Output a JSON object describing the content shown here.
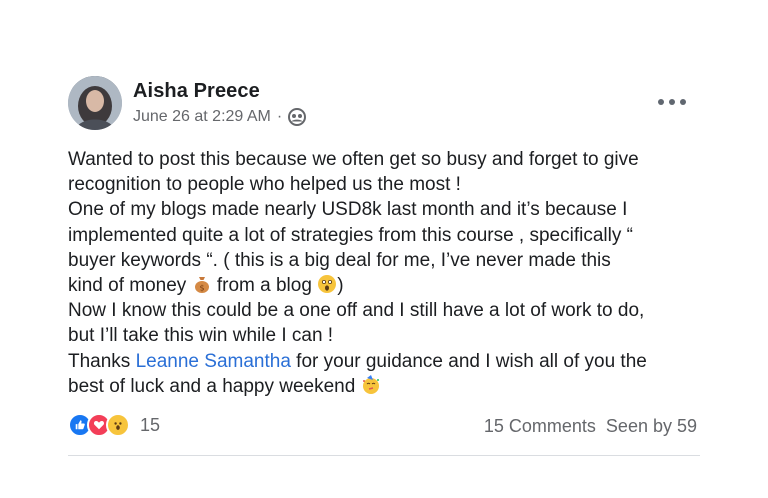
{
  "post": {
    "author": "Aisha Preece",
    "timestamp": "June 26 at 2:29 AM",
    "separator": "·",
    "audience_icon": "group-icon",
    "body_lines": [
      "Wanted to post this because we often get so busy and forget to give",
      "recognition to people who helped us the most !",
      "One of my blogs made nearly USD8k last month and it’s because I",
      "implemented quite a lot of strategies from this course , specifically “",
      "buyer keywords “. ( this is a big deal for me, I’ve never made this"
    ],
    "line6_a": "kind of money ",
    "line6_b": " from a blog ",
    "line6_c": ")",
    "line7": "Now I know this could be a one off and I still have a lot of work to do,",
    "line8": "but I’ll take this win while I can !",
    "line9_a": "Thanks ",
    "mention": "Leanne Samantha",
    "line9_b": " for your guidance and I wish all of you the",
    "line10": "best of luck and a happy weekend ",
    "emojis": [
      "money-bag-icon",
      "astonished-face-icon",
      "party-face-icon"
    ]
  },
  "footer": {
    "reactions": [
      "like-icon",
      "love-icon",
      "wow-icon"
    ],
    "reaction_count": "15",
    "comments": "15 Comments",
    "seen_by": "Seen by 59"
  },
  "colors": {
    "text": "#1c1e21",
    "muted": "#65676b",
    "link": "#2a6fd6",
    "like": "#1877f2",
    "love": "#f33e58",
    "wow": "#f7c43c"
  }
}
